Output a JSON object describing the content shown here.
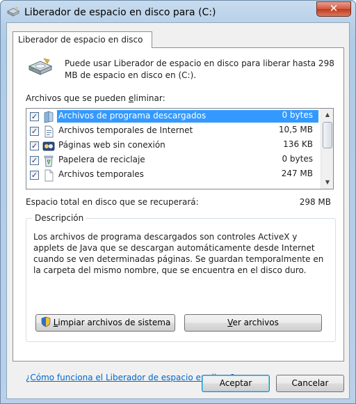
{
  "window": {
    "title": "Liberador de espacio en disco para  (C:)",
    "close_label": "✕"
  },
  "tab": {
    "label": "Liberador de espacio en disco"
  },
  "intro": {
    "text": "Puede usar Liberador de espacio en disco para liberar hasta 298 MB de espacio en disco en  (C:)."
  },
  "files": {
    "label_before": "Archivos que se pueden ",
    "label_mnemonic": "e",
    "label_after": "liminar:",
    "items": [
      {
        "label": "Archivos de programa descargados",
        "size": "0 bytes",
        "checked": true,
        "selected": true,
        "icon": "folder-icon"
      },
      {
        "label": "Archivos temporales de Internet",
        "size": "10,5 MB",
        "checked": true,
        "selected": false,
        "icon": "document-icon"
      },
      {
        "label": "Páginas web sin conexión",
        "size": "136 KB",
        "checked": true,
        "selected": false,
        "icon": "offline-pages-icon"
      },
      {
        "label": "Papelera de reciclaje",
        "size": "0 bytes",
        "checked": true,
        "selected": false,
        "icon": "recycle-bin-icon"
      },
      {
        "label": "Archivos temporales",
        "size": "247 MB",
        "checked": true,
        "selected": false,
        "icon": "blank-file-icon"
      }
    ],
    "check_mark": "✓"
  },
  "total": {
    "label": "Espacio total en disco que se recuperará:",
    "value": "298 MB"
  },
  "description": {
    "title": "Descripción",
    "text": "Los archivos de programa descargados son controles ActiveX y applets de Java que se descargan automáticamente desde Internet cuando se ven determinadas páginas. Se guardan temporalmente en la carpeta del mismo nombre, que se encuentra en el disco duro."
  },
  "buttons": {
    "clean_system_before": "",
    "clean_system_mnemonic": "L",
    "clean_system_after": "impiar archivos de sistema",
    "view_files_before": "",
    "view_files_mnemonic": "V",
    "view_files_after": "er archivos",
    "ok": "Aceptar",
    "cancel": "Cancelar"
  },
  "help_link": "¿Cómo funciona el Liberador de espacio en disco?",
  "colors": {
    "selection": "#3399ff",
    "link": "#0066cc",
    "window_frame": "#b9d1ea"
  }
}
